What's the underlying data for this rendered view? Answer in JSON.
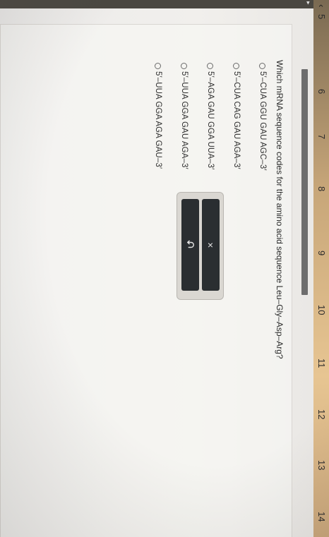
{
  "nav": {
    "back_icon": "chevron-left-icon",
    "questions": [
      "5",
      "6",
      "7",
      "8",
      "9",
      "10",
      "11",
      "12",
      "13",
      "14"
    ]
  },
  "question": {
    "text": "Which mRNA sequence codes for the amino acid sequence Leu–Gly–Asp–Arg?"
  },
  "options": [
    "5′–CUA GGU GAU AGC–3′",
    "5′–CUA CAG GAU AGA–3′",
    "5′–AGA GAU GGA UUA–3′",
    "5′–UUA GGA GAU AGA–3′",
    "5′–UUA GGA AGA GAU–3′"
  ],
  "actions": {
    "clear_icon": "close-icon",
    "undo_icon": "undo-icon",
    "clear_glyph": "×"
  },
  "colors": {
    "button_bg": "#2a2e31",
    "nav_accent": "#e7c592"
  }
}
